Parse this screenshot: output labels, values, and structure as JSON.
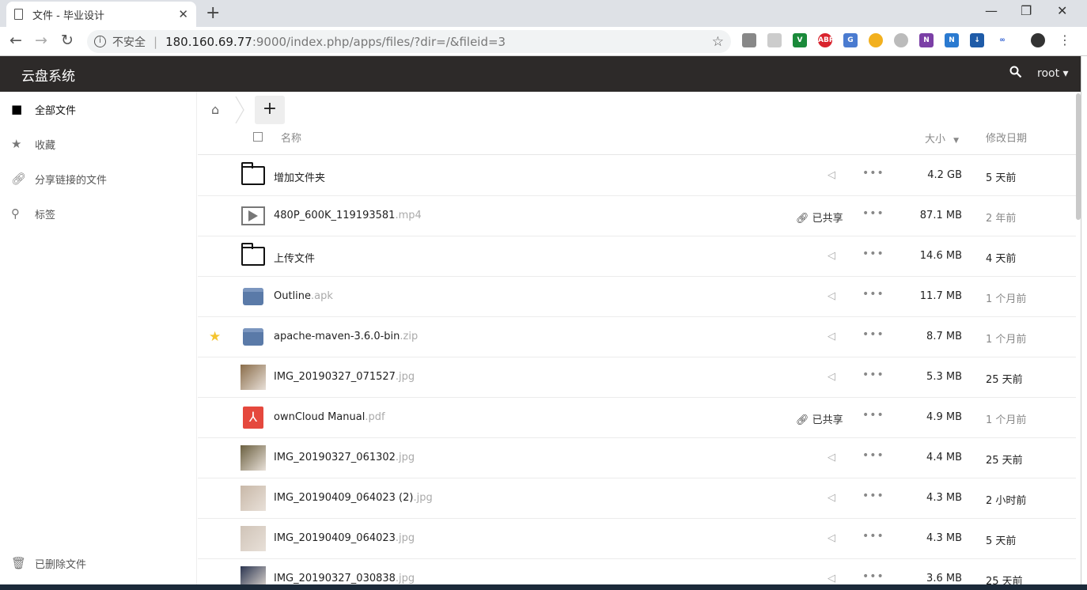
{
  "browser": {
    "tab_title": "文件 - 毕业设计",
    "new_tab": "+",
    "url_insecure": "不安全",
    "url_host": "180.160.69.77",
    "url_path": ":9000/index.php/apps/files/?dir=/&fileid=3"
  },
  "header": {
    "app_name": "云盘系统",
    "user": "root"
  },
  "sidebar": {
    "items": [
      {
        "label": "全部文件",
        "icon": "folder-icon"
      },
      {
        "label": "收藏",
        "icon": "star-icon"
      },
      {
        "label": "分享链接的文件",
        "icon": "link-icon"
      },
      {
        "label": "标签",
        "icon": "search-icon"
      }
    ],
    "trash_label": "已删除文件"
  },
  "table": {
    "col_name": "名称",
    "col_size": "大小",
    "col_date": "修改日期"
  },
  "files": [
    {
      "name": "增加文件夹",
      "ext": "",
      "type": "folder",
      "size": "4.2 GB",
      "date": "5 天前",
      "shared": "",
      "favorite": false
    },
    {
      "name": "480P_600K_119193581",
      "ext": ".mp4",
      "type": "video",
      "size": "87.1 MB",
      "date": "2 年前",
      "shared": "已共享",
      "favorite": false
    },
    {
      "name": "上传文件",
      "ext": "",
      "type": "folder",
      "size": "14.6 MB",
      "date": "4 天前",
      "shared": "",
      "favorite": false
    },
    {
      "name": "Outline",
      "ext": ".apk",
      "type": "package",
      "size": "11.7 MB",
      "date": "1 个月前",
      "shared": "",
      "favorite": false
    },
    {
      "name": "apache-maven-3.6.0-bin",
      "ext": ".zip",
      "type": "package",
      "size": "8.7 MB",
      "date": "1 个月前",
      "shared": "",
      "favorite": true
    },
    {
      "name": "IMG_20190327_071527",
      "ext": ".jpg",
      "type": "image",
      "size": "5.3 MB",
      "date": "25 天前",
      "shared": "",
      "favorite": false
    },
    {
      "name": "ownCloud Manual",
      "ext": ".pdf",
      "type": "pdf",
      "size": "4.9 MB",
      "date": "1 个月前",
      "shared": "已共享",
      "favorite": false
    },
    {
      "name": "IMG_20190327_061302",
      "ext": ".jpg",
      "type": "image",
      "size": "4.4 MB",
      "date": "25 天前",
      "shared": "",
      "favorite": false
    },
    {
      "name": "IMG_20190409_064023 (2)",
      "ext": ".jpg",
      "type": "image",
      "size": "4.3 MB",
      "date": "2 小时前",
      "shared": "",
      "favorite": false
    },
    {
      "name": "IMG_20190409_064023",
      "ext": ".jpg",
      "type": "image",
      "size": "4.3 MB",
      "date": "5 天前",
      "shared": "",
      "favorite": false
    },
    {
      "name": "IMG_20190327_030838",
      "ext": ".jpg",
      "type": "image",
      "size": "3.6 MB",
      "date": "25 天前",
      "shared": "",
      "favorite": false
    }
  ],
  "date_colors": {
    "recent": "#222222",
    "old": "#888888"
  },
  "accent": "#2d2a29"
}
